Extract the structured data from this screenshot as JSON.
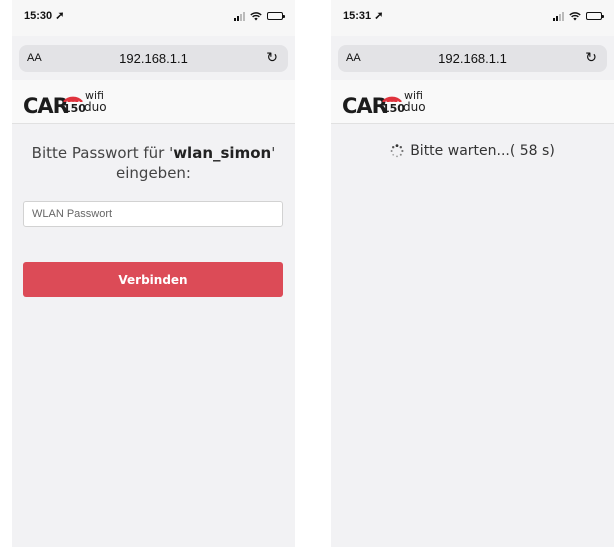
{
  "screens": [
    {
      "status_time": "15:30",
      "url_aa": "AA",
      "url": "192.168.1.1",
      "logo": {
        "car": "CAR",
        "num": "150",
        "wifi": "wifi",
        "duo": "duo"
      },
      "prompt_prefix": "Bitte Passwort für '",
      "ssid": "wlan_simon",
      "prompt_suffix": "' eingeben:",
      "password_placeholder": "WLAN Passwort",
      "password_value": "",
      "connect_label": "Verbinden"
    },
    {
      "status_time": "15:31",
      "url_aa": "AA",
      "url": "192.168.1.1",
      "logo": {
        "car": "CAR",
        "num": "150",
        "wifi": "wifi",
        "duo": "duo"
      },
      "wait_text": "Bitte warten...( 58 s)"
    }
  ],
  "icons": {
    "location": "location-arrow-icon",
    "signal": "cellular-signal-icon",
    "wifi": "wifi-icon",
    "battery": "battery-icon",
    "reload": "reload-icon",
    "spinner": "loading-spinner-icon"
  },
  "colors": {
    "button": "#dc4b57",
    "logo_red": "#e0333d",
    "page_bg": "#f2f2f4"
  }
}
